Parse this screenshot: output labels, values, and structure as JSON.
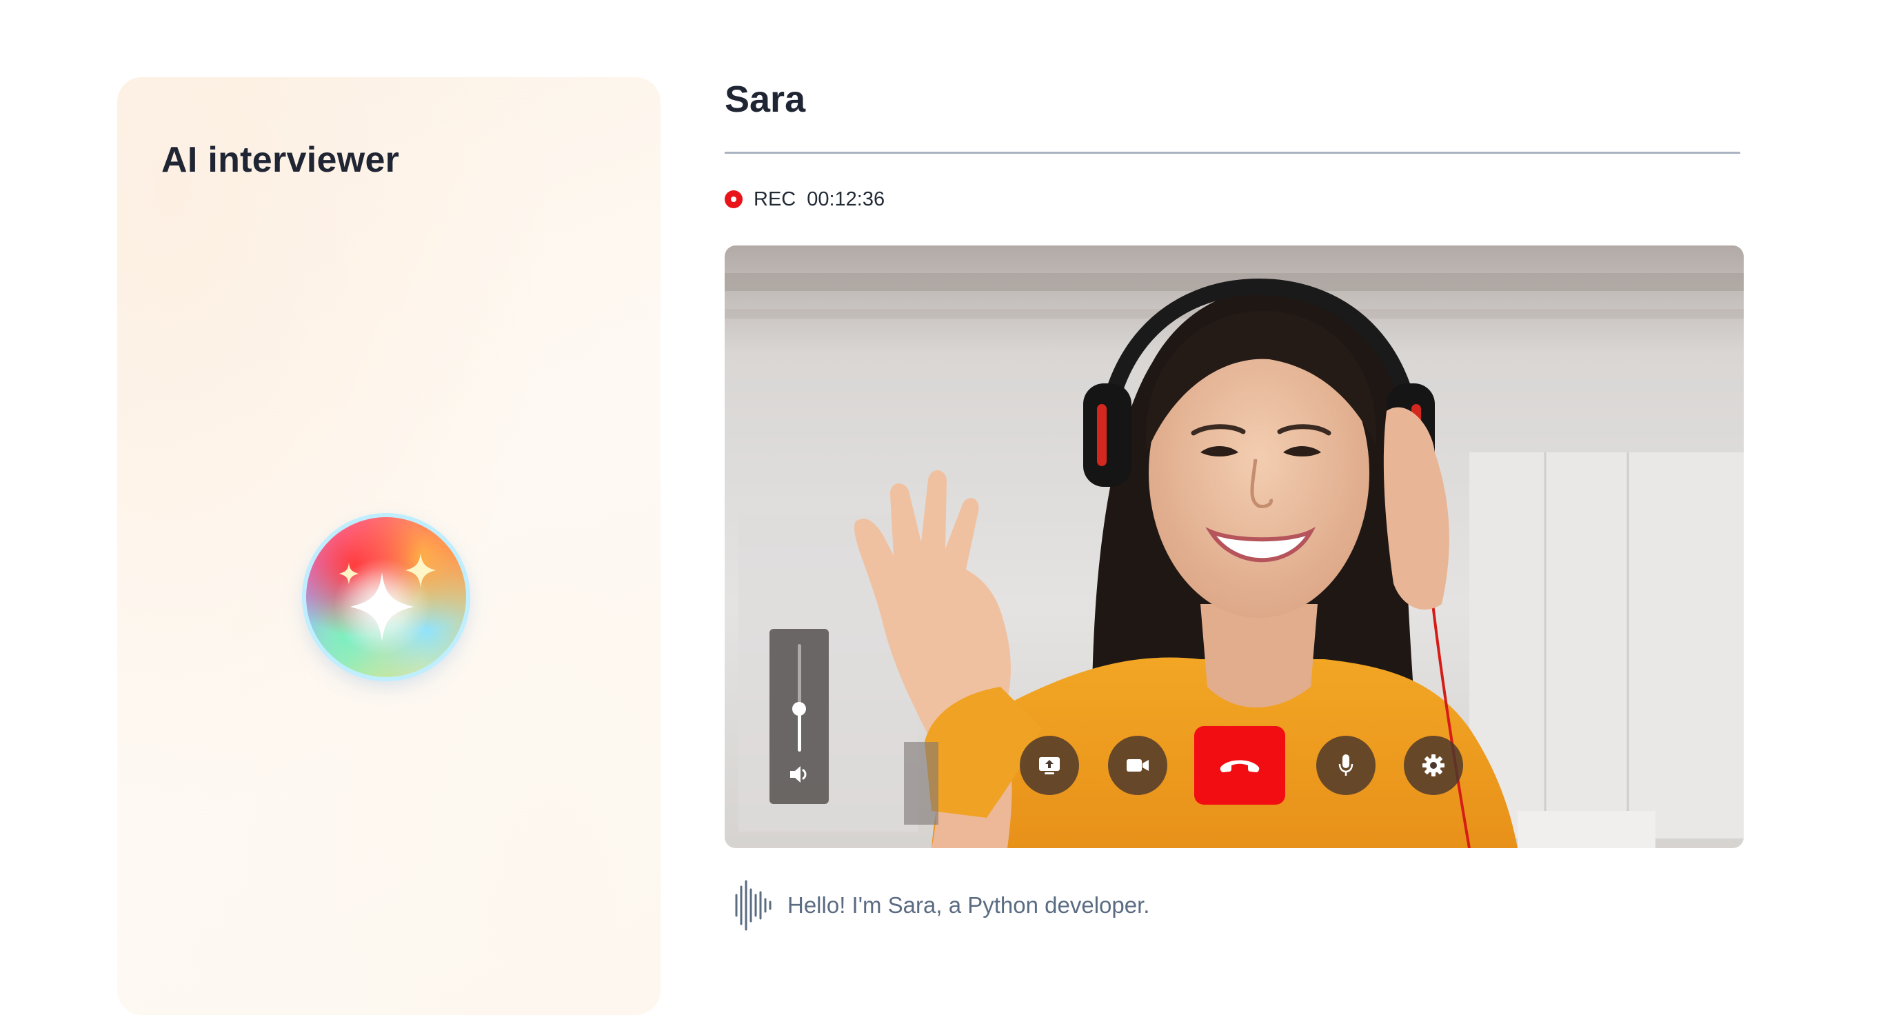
{
  "ai_panel": {
    "title": "AI interviewer",
    "avatar_icon": "sparkles-orb-icon"
  },
  "candidate": {
    "name": "Sara"
  },
  "recording": {
    "label": "REC",
    "elapsed": "00:12:36",
    "indicator_color": "#e8141a"
  },
  "video": {
    "subject": "candidate-webcam-feed",
    "volume_level": 0.4,
    "controls": [
      {
        "id": "share-screen",
        "icon": "share-screen-icon"
      },
      {
        "id": "camera",
        "icon": "video-camera-icon"
      },
      {
        "id": "end-call",
        "icon": "phone-hangup-icon",
        "color": "#f20d13"
      },
      {
        "id": "microphone",
        "icon": "microphone-icon"
      },
      {
        "id": "settings",
        "icon": "gear-icon"
      }
    ]
  },
  "transcript": {
    "icon": "audio-waveform-icon",
    "text": "Hello! I'm Sara, a Python developer."
  }
}
